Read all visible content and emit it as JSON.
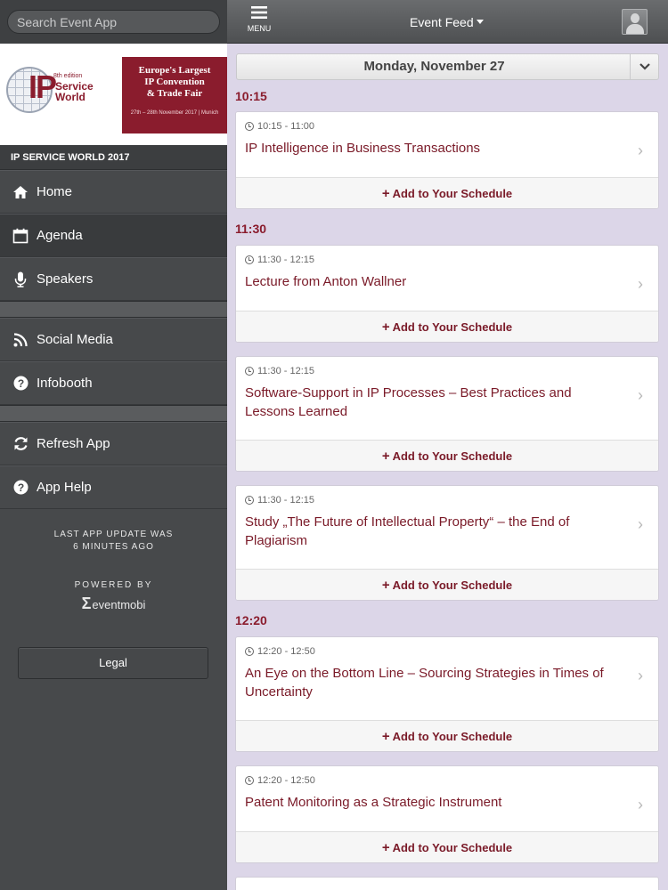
{
  "search": {
    "placeholder": "Search Event App"
  },
  "banner": {
    "logo_letters": "IP",
    "edition": "8th edition",
    "logo_name": "Service\nWorld",
    "tagline": "Europe's Largest\nIP Convention\n& Trade Fair",
    "dates": "27th – 28th November 2017 | Munich"
  },
  "sidebar": {
    "event_name": "IP SERVICE WORLD 2017",
    "items": [
      {
        "label": "Home",
        "icon": "home-icon"
      },
      {
        "label": "Agenda",
        "icon": "calendar-icon",
        "active": true
      },
      {
        "label": "Speakers",
        "icon": "microphone-icon"
      },
      {
        "label": "Social Media",
        "icon": "rss-icon"
      },
      {
        "label": "Infobooth",
        "icon": "question-circle-icon"
      },
      {
        "label": "Refresh App",
        "icon": "refresh-icon"
      },
      {
        "label": "App Help",
        "icon": "question-circle-icon"
      }
    ],
    "last_update": "LAST APP UPDATE WAS\n6 MINUTES AGO",
    "powered_by": "POWERED BY",
    "powered_logo": "eventmobi",
    "legal_label": "Legal"
  },
  "topbar": {
    "menu_label": "MENU",
    "feed_title": "Event Feed"
  },
  "main": {
    "date": "Monday, November 27",
    "add_label": "Add to Your Schedule",
    "groups": [
      {
        "time": "10:15",
        "sessions": [
          {
            "time_range": "10:15 - 11:00",
            "title": "IP Intelligence in Business Transactions"
          }
        ]
      },
      {
        "time": "11:30",
        "sessions": [
          {
            "time_range": "11:30 - 12:15",
            "title": "Lecture from Anton Wallner"
          },
          {
            "time_range": "11:30 - 12:15",
            "title": "Software-Support in IP Processes – Best Practices and Lessons Learned"
          },
          {
            "time_range": "11:30 - 12:15",
            "title": "Study „The Future of Intellectual Property“ – the End of Plagiarism"
          }
        ]
      },
      {
        "time": "12:20",
        "sessions": [
          {
            "time_range": "12:20 - 12:50",
            "title": "An Eye on the Bottom Line – Sourcing Strategies in Times of Uncertainty"
          },
          {
            "time_range": "12:20 - 12:50",
            "title": "Patent Monitoring as a Strategic Instrument"
          }
        ]
      }
    ]
  },
  "colors": {
    "accent": "#8a1c2d",
    "feed_background": "#dcd6e8",
    "sidebar": "#47494b"
  }
}
